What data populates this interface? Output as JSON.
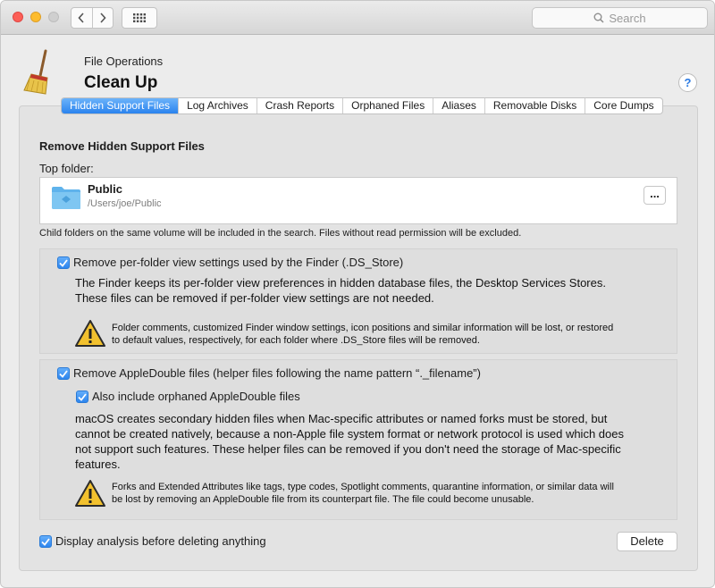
{
  "search": {
    "placeholder": "Search"
  },
  "header": {
    "subtitle": "File Operations",
    "title": "Clean Up",
    "help": "?"
  },
  "tabs": [
    {
      "label": "Hidden Support Files",
      "active": true
    },
    {
      "label": "Log Archives"
    },
    {
      "label": "Crash Reports"
    },
    {
      "label": "Orphaned Files"
    },
    {
      "label": "Aliases"
    },
    {
      "label": "Removable Disks"
    },
    {
      "label": "Core Dumps"
    }
  ],
  "main": {
    "section_title": "Remove Hidden Support Files",
    "top_folder_label": "Top folder:",
    "folder": {
      "name": "Public",
      "path": "/Users/joe/Public",
      "more": "..."
    },
    "child_note": "Child folders on the same volume will be included in the search. Files without read permission will be excluded.",
    "ds_store": {
      "checked": true,
      "label": "Remove per-folder view settings used by the Finder (.DS_Store)",
      "desc_1": "The Finder keeps its per-folder view preferences in hidden database files, the Desktop Services Stores.",
      "desc_2": "These files can be removed if per-folder view settings are not needed.",
      "warn_1": "Folder comments, customized Finder window settings, icon positions and similar information will be lost, or restored",
      "warn_2": "to default values, respectively, for each folder where .DS_Store files will be removed."
    },
    "appledouble": {
      "checked": true,
      "label": "Remove AppleDouble files (helper files following the name pattern “._filename”)",
      "orphan_checked": true,
      "orphan_label": "Also include orphaned AppleDouble files",
      "desc_1": "macOS creates secondary hidden files when Mac-specific attributes or named forks must be stored, but",
      "desc_2": "cannot be created natively, because a non-Apple file system format or network protocol is used which does",
      "desc_3": "not support such features. These helper files can be removed if you don't need the storage of Mac-specific",
      "desc_4": "features.",
      "warn_1": "Forks and Extended Attributes like tags, type codes, Spotlight comments, quarantine information, or similar data will",
      "warn_2": "be lost by removing an AppleDouble file from its counterpart file. The file could become unusable."
    },
    "display_analysis": {
      "checked": true,
      "label": "Display analysis before deleting anything"
    },
    "delete_label": "Delete"
  },
  "colors": {
    "accent": "#2a83ee",
    "close": "#fc5f57",
    "minimize": "#fdbc2e",
    "warning": "#f2c12e"
  }
}
